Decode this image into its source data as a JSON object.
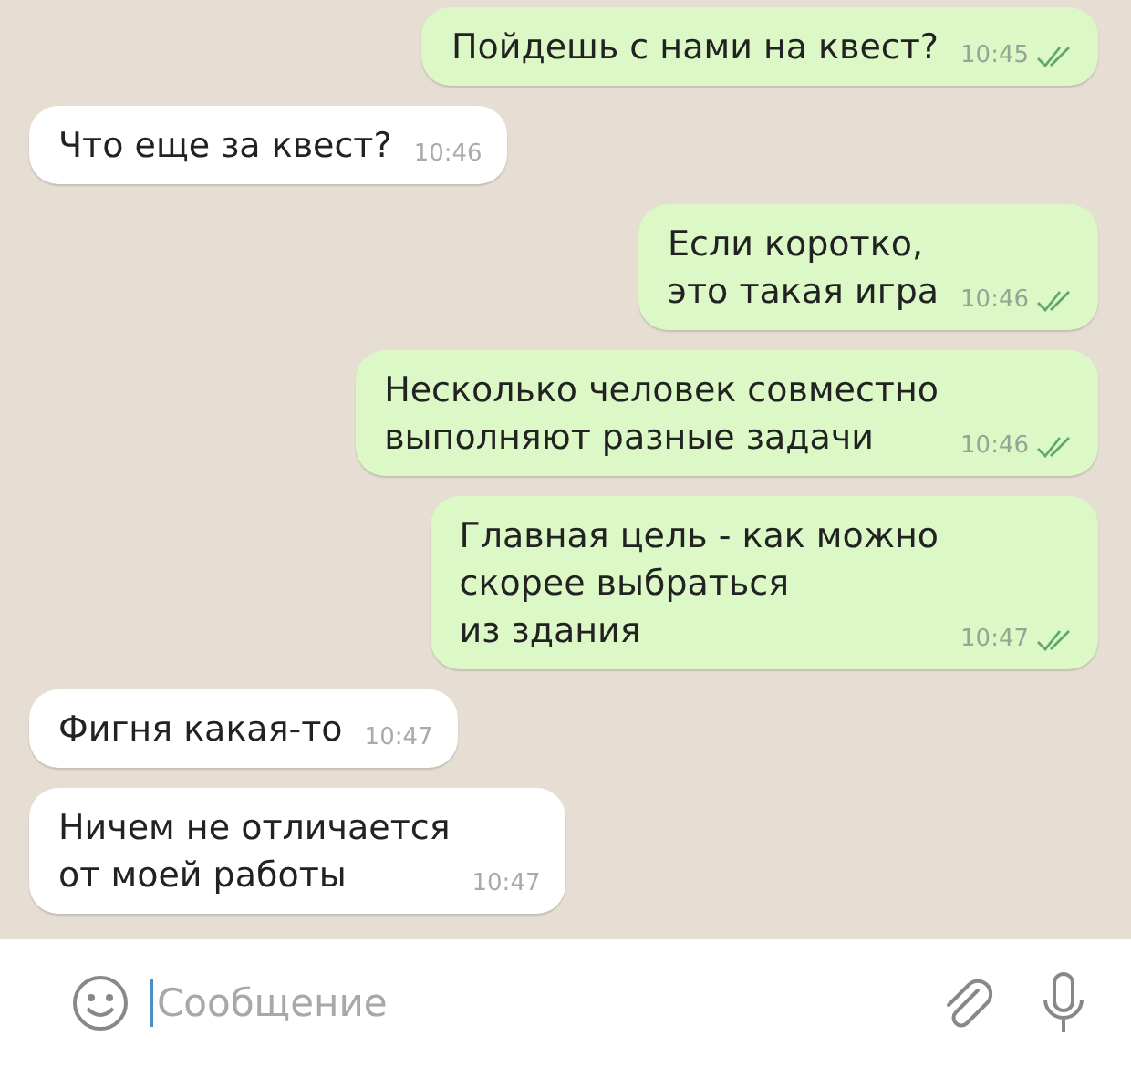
{
  "messages": [
    {
      "outgoing": true,
      "text": "Пойдешь с нами на квест?",
      "time": "10:45",
      "read": true
    },
    {
      "outgoing": false,
      "text": "Что еще за квест?",
      "time": "10:46"
    },
    {
      "outgoing": true,
      "text": "Если коротко,\nэто такая игра",
      "time": "10:46",
      "read": true
    },
    {
      "outgoing": true,
      "text": "Несколько человек совместно\nвыполняют разные задачи",
      "time": "10:46",
      "read": true
    },
    {
      "outgoing": true,
      "text": "Главная цель - как можно\nскорее выбраться\nиз здания",
      "time": "10:47",
      "read": true
    },
    {
      "outgoing": false,
      "text": "Фигня какая-то",
      "time": "10:47"
    },
    {
      "outgoing": false,
      "text": "Ничем не отличается\nот моей работы",
      "time": "10:47"
    }
  ],
  "composer": {
    "placeholder": "Сообщение"
  }
}
